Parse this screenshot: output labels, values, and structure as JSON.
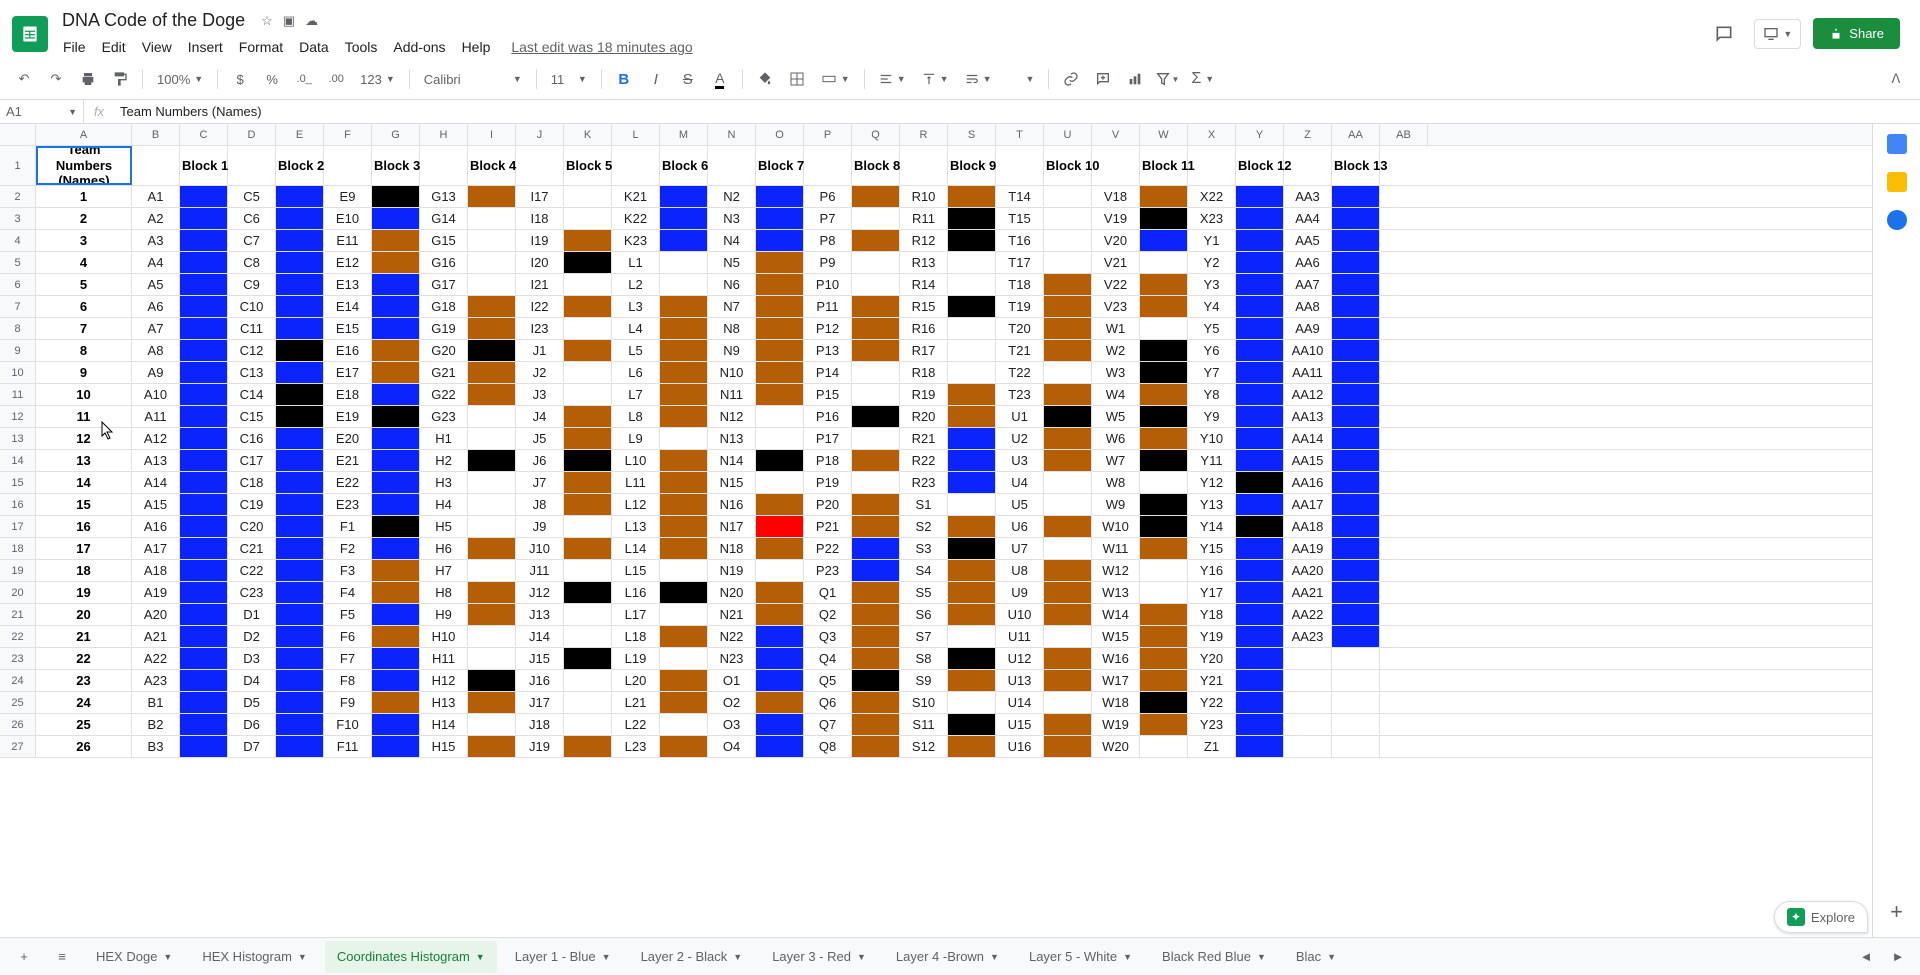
{
  "doc": {
    "title": "DNA Code of the Doge"
  },
  "menus": [
    "File",
    "Edit",
    "View",
    "Insert",
    "Format",
    "Data",
    "Tools",
    "Add-ons",
    "Help"
  ],
  "last_edit": "Last edit was 18 minutes ago",
  "share_label": "Share",
  "toolbar": {
    "zoom": "100%",
    "font": "Calibri",
    "size": "11"
  },
  "namebox": "A1",
  "formula": "Team Numbers (Names)",
  "colors": {
    "blue": "#0b24fb",
    "black": "#000000",
    "brown": "#b45f06",
    "red": "#ff0000",
    "white": "#ffffff"
  },
  "col_widths": {
    "team": 96,
    "label": 48,
    "color": 48
  },
  "col_letters": [
    "A",
    "B",
    "C",
    "D",
    "E",
    "F",
    "G",
    "H",
    "I",
    "J",
    "K",
    "L",
    "M",
    "N",
    "O",
    "P",
    "Q",
    "R",
    "S",
    "T",
    "U",
    "V",
    "W",
    "X",
    "Y",
    "Z",
    "AA",
    "AB"
  ],
  "blocks": [
    {
      "name": "Block 1",
      "labels": [
        "A1",
        "A2",
        "A3",
        "A4",
        "A5",
        "A6",
        "A7",
        "A8",
        "A9",
        "A10",
        "A11",
        "A12",
        "A13",
        "A14",
        "A15",
        "A16",
        "A17",
        "A18",
        "A19",
        "A20",
        "A21",
        "A22",
        "A23",
        "B1",
        "B2",
        "B3"
      ],
      "colors": [
        "blue",
        "blue",
        "blue",
        "blue",
        "blue",
        "blue",
        "blue",
        "blue",
        "blue",
        "blue",
        "blue",
        "blue",
        "blue",
        "blue",
        "blue",
        "blue",
        "blue",
        "blue",
        "blue",
        "blue",
        "blue",
        "blue",
        "blue",
        "blue",
        "blue",
        "blue"
      ]
    },
    {
      "name": "Block 2",
      "labels": [
        "C5",
        "C6",
        "C7",
        "C8",
        "C9",
        "C10",
        "C11",
        "C12",
        "C13",
        "C14",
        "C15",
        "C16",
        "C17",
        "C18",
        "C19",
        "C20",
        "C21",
        "C22",
        "C23",
        "D1",
        "D2",
        "D3",
        "D4",
        "D5",
        "D6",
        "D7"
      ],
      "colors": [
        "blue",
        "blue",
        "blue",
        "blue",
        "blue",
        "blue",
        "blue",
        "black",
        "blue",
        "black",
        "black",
        "blue",
        "blue",
        "blue",
        "blue",
        "blue",
        "blue",
        "blue",
        "blue",
        "blue",
        "blue",
        "blue",
        "blue",
        "blue",
        "blue",
        "blue"
      ]
    },
    {
      "name": "Block 3",
      "labels": [
        "E9",
        "E10",
        "E11",
        "E12",
        "E13",
        "E14",
        "E15",
        "E16",
        "E17",
        "E18",
        "E19",
        "E20",
        "E21",
        "E22",
        "E23",
        "F1",
        "F2",
        "F3",
        "F4",
        "F5",
        "F6",
        "F7",
        "F8",
        "F9",
        "F10",
        "F11"
      ],
      "colors": [
        "black",
        "blue",
        "brown",
        "brown",
        "blue",
        "blue",
        "blue",
        "brown",
        "brown",
        "blue",
        "black",
        "blue",
        "blue",
        "blue",
        "blue",
        "black",
        "blue",
        "brown",
        "brown",
        "blue",
        "brown",
        "blue",
        "blue",
        "brown",
        "blue",
        "blue"
      ]
    },
    {
      "name": "Block 4",
      "labels": [
        "G13",
        "G14",
        "G15",
        "G16",
        "G17",
        "G18",
        "G19",
        "G20",
        "G21",
        "G22",
        "G23",
        "H1",
        "H2",
        "H3",
        "H4",
        "H5",
        "H6",
        "H7",
        "H8",
        "H9",
        "H10",
        "H11",
        "H12",
        "H13",
        "H14",
        "H15"
      ],
      "colors": [
        "brown",
        "white",
        "white",
        "white",
        "white",
        "brown",
        "brown",
        "black",
        "brown",
        "brown",
        "white",
        "white",
        "black",
        "white",
        "white",
        "white",
        "brown",
        "white",
        "brown",
        "brown",
        "white",
        "white",
        "black",
        "brown",
        "white",
        "brown"
      ]
    },
    {
      "name": "Block 5",
      "labels": [
        "I17",
        "I18",
        "I19",
        "I20",
        "I21",
        "I22",
        "I23",
        "J1",
        "J2",
        "J3",
        "J4",
        "J5",
        "J6",
        "J7",
        "J8",
        "J9",
        "J10",
        "J11",
        "J12",
        "J13",
        "J14",
        "J15",
        "J16",
        "J17",
        "J18",
        "J19"
      ],
      "colors": [
        "white",
        "white",
        "brown",
        "black",
        "white",
        "brown",
        "white",
        "brown",
        "white",
        "white",
        "brown",
        "brown",
        "black",
        "brown",
        "brown",
        "white",
        "brown",
        "white",
        "black",
        "white",
        "white",
        "black",
        "white",
        "white",
        "white",
        "brown"
      ]
    },
    {
      "name": "Block 6",
      "labels": [
        "K21",
        "K22",
        "K23",
        "L1",
        "L2",
        "L3",
        "L4",
        "L5",
        "L6",
        "L7",
        "L8",
        "L9",
        "L10",
        "L11",
        "L12",
        "L13",
        "L14",
        "L15",
        "L16",
        "L17",
        "L18",
        "L19",
        "L20",
        "L21",
        "L22",
        "L23"
      ],
      "colors": [
        "blue",
        "blue",
        "blue",
        "white",
        "white",
        "brown",
        "brown",
        "brown",
        "brown",
        "brown",
        "brown",
        "white",
        "brown",
        "brown",
        "brown",
        "brown",
        "brown",
        "white",
        "black",
        "white",
        "brown",
        "white",
        "brown",
        "brown",
        "white",
        "brown"
      ]
    },
    {
      "name": "Block 7",
      "labels": [
        "N2",
        "N3",
        "N4",
        "N5",
        "N6",
        "N7",
        "N8",
        "N9",
        "N10",
        "N11",
        "N12",
        "N13",
        "N14",
        "N15",
        "N16",
        "N17",
        "N18",
        "N19",
        "N20",
        "N21",
        "N22",
        "N23",
        "O1",
        "O2",
        "O3",
        "O4"
      ],
      "colors": [
        "blue",
        "blue",
        "blue",
        "brown",
        "brown",
        "brown",
        "brown",
        "brown",
        "brown",
        "brown",
        "white",
        "white",
        "black",
        "white",
        "brown",
        "red",
        "brown",
        "white",
        "brown",
        "brown",
        "blue",
        "blue",
        "blue",
        "brown",
        "blue",
        "blue"
      ]
    },
    {
      "name": "Block 8",
      "labels": [
        "P6",
        "P7",
        "P8",
        "P9",
        "P10",
        "P11",
        "P12",
        "P13",
        "P14",
        "P15",
        "P16",
        "P17",
        "P18",
        "P19",
        "P20",
        "P21",
        "P22",
        "P23",
        "Q1",
        "Q2",
        "Q3",
        "Q4",
        "Q5",
        "Q6",
        "Q7",
        "Q8"
      ],
      "colors": [
        "brown",
        "white",
        "brown",
        "white",
        "white",
        "brown",
        "brown",
        "brown",
        "white",
        "white",
        "black",
        "white",
        "brown",
        "white",
        "brown",
        "brown",
        "blue",
        "blue",
        "brown",
        "brown",
        "brown",
        "brown",
        "black",
        "brown",
        "brown",
        "brown"
      ]
    },
    {
      "name": "Block 9",
      "labels": [
        "R10",
        "R11",
        "R12",
        "R13",
        "R14",
        "R15",
        "R16",
        "R17",
        "R18",
        "R19",
        "R20",
        "R21",
        "R22",
        "R23",
        "S1",
        "S2",
        "S3",
        "S4",
        "S5",
        "S6",
        "S7",
        "S8",
        "S9",
        "S10",
        "S11",
        "S12"
      ],
      "colors": [
        "brown",
        "black",
        "black",
        "white",
        "white",
        "black",
        "white",
        "white",
        "white",
        "brown",
        "brown",
        "blue",
        "blue",
        "blue",
        "white",
        "brown",
        "black",
        "brown",
        "brown",
        "brown",
        "white",
        "black",
        "brown",
        "white",
        "black",
        "brown"
      ]
    },
    {
      "name": "Block 10",
      "labels": [
        "T14",
        "T15",
        "T16",
        "T17",
        "T18",
        "T19",
        "T20",
        "T21",
        "T22",
        "T23",
        "U1",
        "U2",
        "U3",
        "U4",
        "U5",
        "U6",
        "U7",
        "U8",
        "U9",
        "U10",
        "U11",
        "U12",
        "U13",
        "U14",
        "U15",
        "U16"
      ],
      "colors": [
        "white",
        "white",
        "white",
        "white",
        "brown",
        "brown",
        "brown",
        "brown",
        "white",
        "brown",
        "black",
        "brown",
        "brown",
        "white",
        "white",
        "brown",
        "white",
        "brown",
        "brown",
        "brown",
        "white",
        "brown",
        "brown",
        "white",
        "brown",
        "brown"
      ]
    },
    {
      "name": "Block 11",
      "labels": [
        "V18",
        "V19",
        "V20",
        "V21",
        "V22",
        "V23",
        "W1",
        "W2",
        "W3",
        "W4",
        "W5",
        "W6",
        "W7",
        "W8",
        "W9",
        "W10",
        "W11",
        "W12",
        "W13",
        "W14",
        "W15",
        "W16",
        "W17",
        "W18",
        "W19",
        "W20"
      ],
      "colors": [
        "brown",
        "black",
        "blue",
        "white",
        "brown",
        "brown",
        "white",
        "black",
        "black",
        "brown",
        "black",
        "brown",
        "black",
        "white",
        "black",
        "black",
        "brown",
        "white",
        "white",
        "brown",
        "brown",
        "brown",
        "brown",
        "black",
        "brown",
        "white"
      ]
    },
    {
      "name": "Block 12",
      "labels": [
        "X22",
        "X23",
        "Y1",
        "Y2",
        "Y3",
        "Y4",
        "Y5",
        "Y6",
        "Y7",
        "Y8",
        "Y9",
        "Y10",
        "Y11",
        "Y12",
        "Y13",
        "Y14",
        "Y15",
        "Y16",
        "Y17",
        "Y18",
        "Y19",
        "Y20",
        "Y21",
        "Y22",
        "Y23",
        "Z1"
      ],
      "colors": [
        "blue",
        "blue",
        "blue",
        "blue",
        "blue",
        "blue",
        "blue",
        "blue",
        "blue",
        "blue",
        "blue",
        "blue",
        "blue",
        "black",
        "blue",
        "black",
        "blue",
        "blue",
        "blue",
        "blue",
        "blue",
        "blue",
        "blue",
        "blue",
        "blue",
        "blue"
      ]
    },
    {
      "name": "Block 13",
      "labels": [
        "AA3",
        "AA4",
        "AA5",
        "AA6",
        "AA7",
        "AA8",
        "AA9",
        "AA10",
        "AA11",
        "AA12",
        "AA13",
        "AA14",
        "AA15",
        "AA16",
        "AA17",
        "AA18",
        "AA19",
        "AA20",
        "AA21",
        "AA22",
        "AA23",
        "",
        "",
        "",
        "",
        ""
      ],
      "colors": [
        "blue",
        "blue",
        "blue",
        "blue",
        "blue",
        "blue",
        "blue",
        "blue",
        "blue",
        "blue",
        "blue",
        "blue",
        "blue",
        "blue",
        "blue",
        "blue",
        "blue",
        "blue",
        "blue",
        "blue",
        "blue",
        "white",
        "white",
        "white",
        "white",
        "white"
      ]
    }
  ],
  "header_team": "Team Numbers\n(Names)",
  "row_count": 26,
  "tabs": [
    "HEX Doge",
    "HEX Histogram",
    "Coordinates Histogram",
    "Layer 1 - Blue",
    "Layer 2 - Black",
    "Layer 3 - Red",
    "Layer 4 -Brown",
    "Layer 5 - White",
    "Black Red Blue",
    "Blac"
  ],
  "active_tab": 2,
  "explore_label": "Explore"
}
